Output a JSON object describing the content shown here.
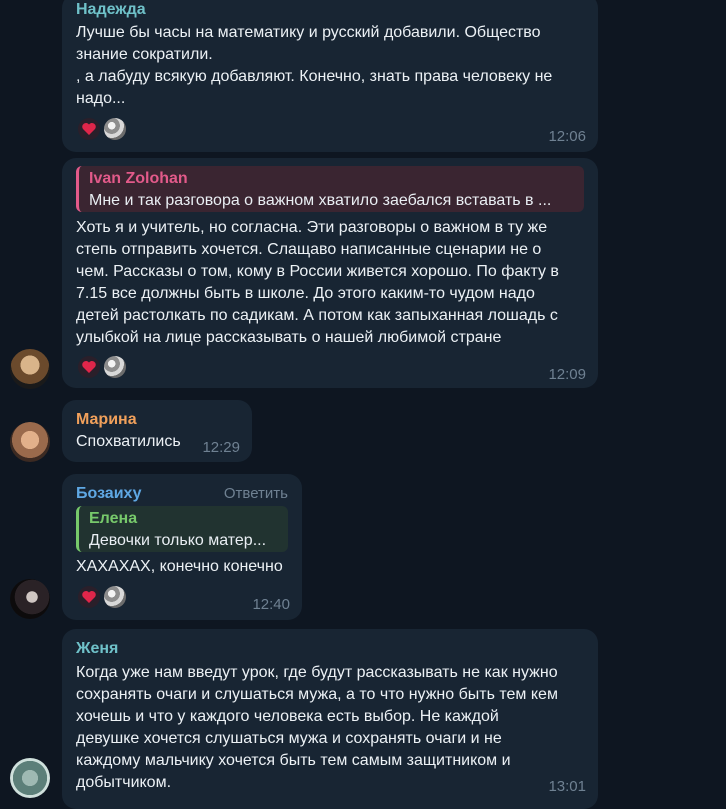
{
  "colors": {
    "background": "#0e1621",
    "bubble": "#182533",
    "time": "#6f8192"
  },
  "messages": [
    {
      "id": "m1",
      "author": "Надежда",
      "author_color": "#6fc1c9",
      "lines": [
        "Лучше бы часы на математику и русский добавили. Общество",
        "знание сократили.",
        ", а лабуду всякую добавляют. Конечно, знать права человеку не",
        "надо..."
      ],
      "time": "12:06",
      "reactions": [
        "heart",
        "sticker"
      ]
    },
    {
      "id": "m2",
      "quote": {
        "author": "Ivan Zolohan",
        "author_color": "#e25a8a",
        "bar_color": "#e25a8a",
        "bg": "#3a2531",
        "text": "Мне и так разговора о важном хватило заебался вставать в ..."
      },
      "lines": [
        "Хоть я и учитель, но согласна. Эти разговоры о важном в ту же",
        "степь отправить хочется. Слащаво написанные сценарии не о",
        "чем. Рассказы о том, кому в России живется хорошо. По факту в",
        "7.15 все должны быть в школе. До этого каким-то чудом надо",
        "детей растолкать по садикам. А потом как запыханная лошадь с",
        "улыбкой на лице рассказывать о нашей любимой стране"
      ],
      "time": "12:09",
      "reactions": [
        "heart",
        "sticker"
      ]
    },
    {
      "id": "m3",
      "author": "Марина",
      "author_color": "#f0a05b",
      "lines": [
        "Спохватились"
      ],
      "time": "12:29"
    },
    {
      "id": "m4",
      "author": "Бозаиху",
      "author_color": "#5fa8e4",
      "reply_label": "Ответить",
      "quote": {
        "author": "Елена",
        "author_color": "#77c96b",
        "bar_color": "#77c96b",
        "bg": "#213330",
        "text": "Девочки только матер..."
      },
      "lines": [
        "ХАХАХАХ, конечно конечно"
      ],
      "time": "12:40",
      "reactions": [
        "heart",
        "sticker"
      ]
    },
    {
      "id": "m5",
      "author": "Женя",
      "author_color": "#6fc1c9",
      "lines": [
        "Когда уже нам введут урок, где будут рассказывать не как нужно",
        "сохранять очаги и слушаться мужа, а то что нужно быть тем кем",
        "хочешь и что у каждого человека есть выбор. Не каждой",
        "девушке хочется слушаться мужа и сохранять очаги и не",
        "каждому мальчику хочется быть тем самым защитником и",
        "добытчиком."
      ],
      "time": "13:01"
    }
  ]
}
